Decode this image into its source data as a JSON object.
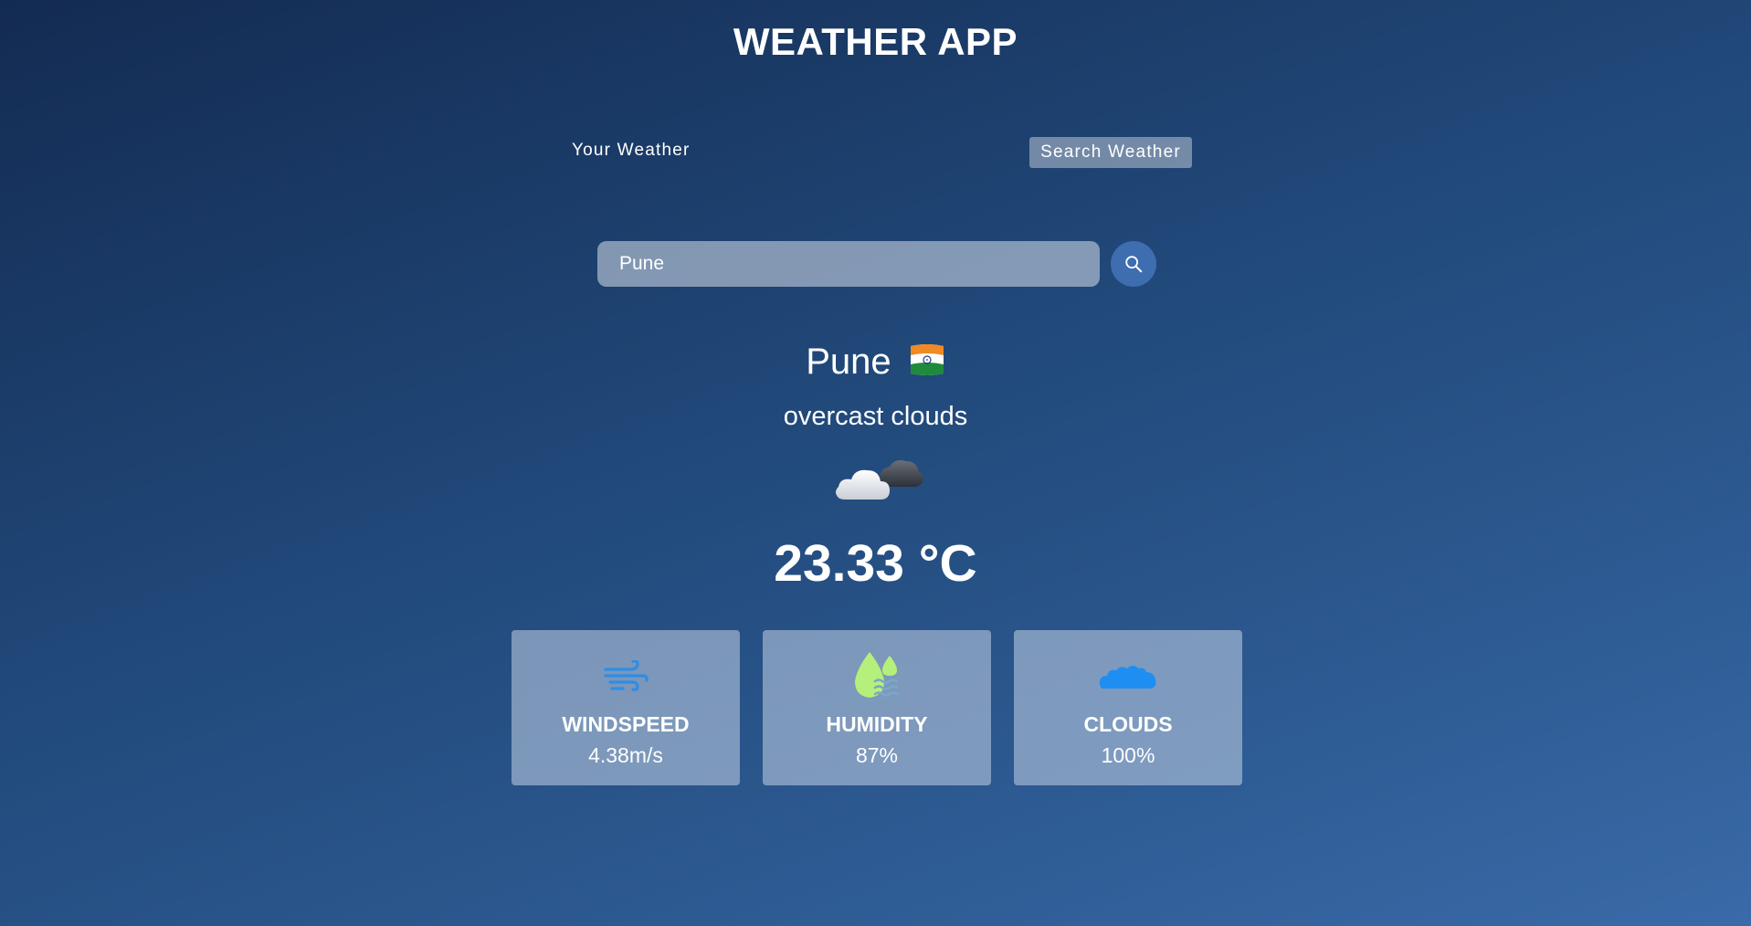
{
  "app": {
    "title": "WEATHER APP"
  },
  "tabs": [
    {
      "label": "Your Weather",
      "active": false
    },
    {
      "label": "Search Weather",
      "active": true
    }
  ],
  "search": {
    "value": "Pune",
    "placeholder": "Search for city...",
    "button_icon": "search-icon"
  },
  "weather": {
    "city": "Pune",
    "country_flag": "india-flag",
    "description": "overcast clouds",
    "icon": "cloud-icon",
    "temperature": "23.33 °C"
  },
  "stats": [
    {
      "icon": "wind-icon",
      "label": "WINDSPEED",
      "value": "4.38m/s",
      "icon_color": "#2f8de4"
    },
    {
      "icon": "humidity-icon",
      "label": "HUMIDITY",
      "value": "87%",
      "icon_color": "#b5f07a"
    },
    {
      "icon": "clouds-icon",
      "label": "CLOUDS",
      "value": "100%",
      "icon_color": "#1f8ef2"
    }
  ],
  "colors": {
    "background_top": "#132b52",
    "background_bottom": "#3a6aa8",
    "search_button": "#3e6db0"
  }
}
